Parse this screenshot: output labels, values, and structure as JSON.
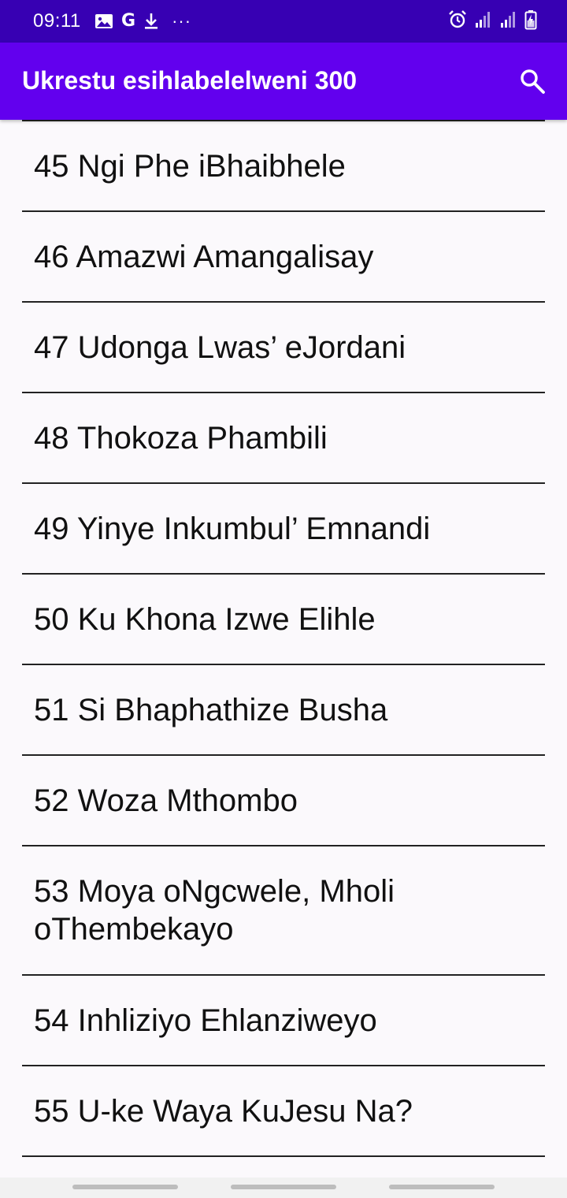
{
  "status_bar": {
    "time": "09:11",
    "left_icons": [
      "image-icon",
      "google-icon",
      "download-icon",
      "more-dots-icon"
    ],
    "right_icons": [
      "alarm-icon",
      "signal-icon",
      "signal-icon-2",
      "battery-charging-icon"
    ],
    "google_letter": "G",
    "more_dots": "···"
  },
  "app_bar": {
    "title": "Ukrestu esihlabelelweni 300",
    "search_icon": "search-icon",
    "color": "#6200ee"
  },
  "colors": {
    "status_bar": "#3700b3",
    "app_bar": "#6200ee",
    "background": "#fbf9fc",
    "divider": "#222222"
  },
  "hymns": [
    {
      "label": "45 Ngi Phe iBhaibhele"
    },
    {
      "label": "46 Amazwi Amangalisay"
    },
    {
      "label": "47 Udonga Lwas’ eJordani"
    },
    {
      "label": "48 Thokoza Phambili"
    },
    {
      "label": "49 Yinye Inkumbul’ Emnandi"
    },
    {
      "label": "50 Ku Khona Izwe Elihle"
    },
    {
      "label": "51 Si Bhaphathize Busha"
    },
    {
      "label": "52 Woza Mthombo"
    },
    {
      "label": "53 Moya oNgcwele, Mholi oThembekayo"
    },
    {
      "label": "54 Inhliziyo Ehlanziweyo"
    },
    {
      "label": "55 U-ke Waya KuJesu Na?"
    }
  ]
}
